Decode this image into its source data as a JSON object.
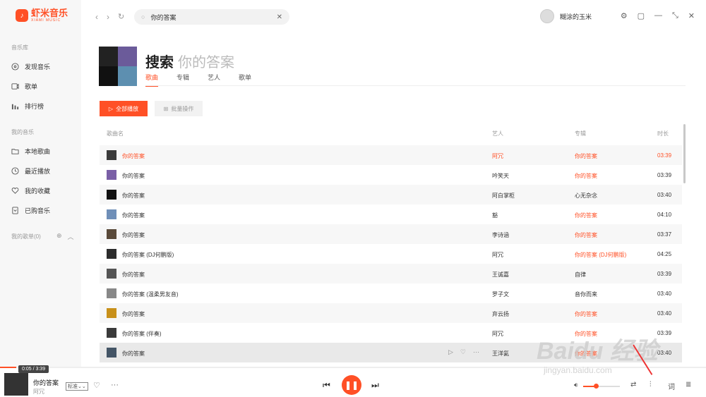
{
  "app": {
    "logo_cn": "虾米音乐",
    "logo_en": "XIAMI MUSIC",
    "accent": "#ff5026"
  },
  "sidebar": {
    "section_library": "音乐库",
    "library_items": [
      {
        "label": "发现音乐",
        "icon": "disc-icon"
      },
      {
        "label": "歌单",
        "icon": "playlist-icon"
      },
      {
        "label": "排行榜",
        "icon": "chart-icon"
      }
    ],
    "section_my": "我的音乐",
    "my_items": [
      {
        "label": "本地歌曲",
        "icon": "folder-icon"
      },
      {
        "label": "最近播放",
        "icon": "clock-icon"
      },
      {
        "label": "我的收藏",
        "icon": "heart-icon"
      },
      {
        "label": "已购音乐",
        "icon": "purchased-icon"
      }
    ],
    "my_playlists": "我的歌单(0)"
  },
  "topbar": {
    "search_value": "你的答案",
    "user_name": "糊涂的玉米"
  },
  "header": {
    "title": "搜索",
    "query": "你的答案",
    "tabs": [
      {
        "label": "歌曲",
        "active": true
      },
      {
        "label": "专辑",
        "active": false
      },
      {
        "label": "艺人",
        "active": false
      },
      {
        "label": "歌单",
        "active": false
      }
    ]
  },
  "actions": {
    "play_all": "全部播放",
    "batch": "批量操作"
  },
  "table": {
    "columns": {
      "name": "歌曲名",
      "artist": "艺人",
      "album": "专辑",
      "duration": "时长"
    },
    "rows": [
      {
        "name": "你的答案",
        "artist": "阿冗",
        "album": "你的答案",
        "album_red": true,
        "duration": "03:39",
        "thumb": "#3a3a3a"
      },
      {
        "name": "你的答案",
        "artist": "吟笑天",
        "album": "你的答案",
        "album_red": true,
        "duration": "03:39",
        "thumb": "#7a5fa6"
      },
      {
        "name": "你的答案",
        "artist": "阿白掌柜",
        "album": "心无杂念",
        "album_red": false,
        "duration": "03:40",
        "thumb": "#111111"
      },
      {
        "name": "你的答案",
        "artist": "豁",
        "album": "你的答案",
        "album_red": true,
        "duration": "04:10",
        "thumb": "#6f8fb8"
      },
      {
        "name": "你的答案",
        "artist": "李诗涵",
        "album": "你的答案",
        "album_red": true,
        "duration": "03:37",
        "thumb": "#5a4a3a"
      },
      {
        "name": "你的答案 (DJ何鹏版)",
        "artist": "阿冗",
        "album": "你的答案 (DJ何鹏版)",
        "album_red": true,
        "duration": "04:25",
        "thumb": "#2c2c2c"
      },
      {
        "name": "你的答案",
        "artist": "王诚嘉",
        "album": "自律",
        "album_red": false,
        "duration": "03:39",
        "thumb": "#555555"
      },
      {
        "name": "你的答案 (温柔男友音)",
        "artist": "罗子文",
        "album": "音你而来",
        "album_red": false,
        "duration": "03:40",
        "thumb": "#888888"
      },
      {
        "name": "你的答案",
        "artist": "弃云扬",
        "album": "你的答案",
        "album_red": true,
        "duration": "03:40",
        "thumb": "#c8901a"
      },
      {
        "name": "你的答案 (伴奏)",
        "artist": "阿冗",
        "album": "你的答案",
        "album_red": true,
        "duration": "03:39",
        "thumb": "#3a3a3a"
      },
      {
        "name": "你的答案",
        "artist": "王洋氦",
        "album": "你的答案",
        "album_red": true,
        "duration": "03:40",
        "thumb": "#445566"
      }
    ]
  },
  "player": {
    "time": "0:05 / 3:39",
    "title": "你的答案",
    "artist": "阿冗",
    "quality": "标准",
    "lyrics_label": "词",
    "progress": 0.023,
    "volume": 0.35
  },
  "watermark": {
    "main": "Baidu 经验",
    "sub": "jingyan.baidu.com"
  }
}
